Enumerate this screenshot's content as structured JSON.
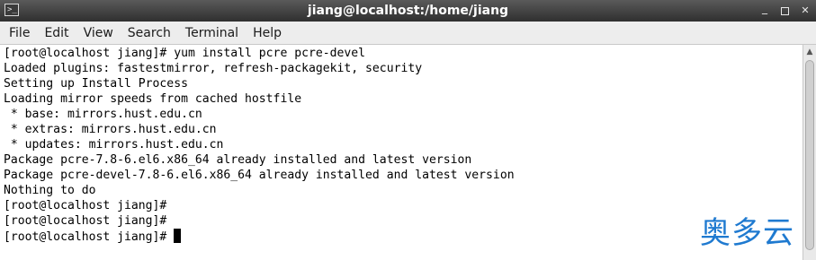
{
  "window": {
    "title": "jiang@localhost:/home/jiang",
    "app_icon_glyph": ">_",
    "app_icon": "terminal-icon",
    "controls": {
      "minimize": "_",
      "close": "✕"
    }
  },
  "menubar": {
    "items": [
      "File",
      "Edit",
      "View",
      "Search",
      "Terminal",
      "Help"
    ]
  },
  "terminal": {
    "lines": [
      "[root@localhost jiang]# yum install pcre pcre-devel",
      "Loaded plugins: fastestmirror, refresh-packagekit, security",
      "Setting up Install Process",
      "Loading mirror speeds from cached hostfile",
      " * base: mirrors.hust.edu.cn",
      " * extras: mirrors.hust.edu.cn",
      " * updates: mirrors.hust.edu.cn",
      "Package pcre-7.8-6.el6.x86_64 already installed and latest version",
      "Package pcre-devel-7.8-6.el6.x86_64 already installed and latest version",
      "Nothing to do",
      "[root@localhost jiang]#",
      "[root@localhost jiang]#",
      "[root@localhost jiang]# "
    ]
  },
  "scrollbar": {
    "up_arrow": "▲"
  },
  "watermark": {
    "text": "奥多云"
  },
  "colors": {
    "title_bar": "#3a3a3a",
    "menu_bar": "#ededed",
    "terminal_bg": "#ffffff",
    "terminal_fg": "#000000",
    "watermark": "#1f7ad0"
  }
}
